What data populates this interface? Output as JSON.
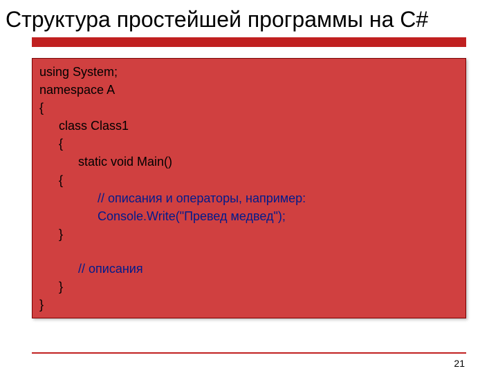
{
  "title": "Структура простейшей программы на C#",
  "code": {
    "l1": "using System;",
    "l2": "namespace A",
    "l3": "{",
    "l4": "class Class1",
    "l5": "{",
    "l6": "static void Main()",
    "l7": "{",
    "l8": "// описания и операторы, например:",
    "l9": "Console.Write(\"Превед медвед\");",
    "l10": "}",
    "l11": "// описания",
    "l12": "}",
    "l13": "}"
  },
  "page_number": "21"
}
